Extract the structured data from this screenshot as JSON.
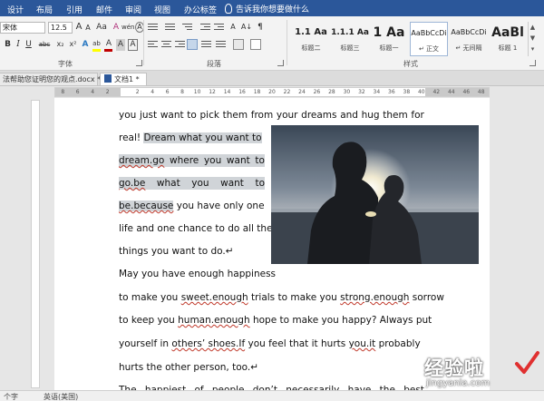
{
  "ribbon_tabs": [
    "设计",
    "布局",
    "引用",
    "邮件",
    "审阅",
    "视图",
    "办公标签"
  ],
  "tell_me": "告诉我你想要做什么",
  "font": {
    "name": "宋体(正文)",
    "name_display": "宋体",
    "size": "12.5"
  },
  "buttons": {
    "grow": "A",
    "shrink": "A",
    "change_case": "Aa",
    "clear_format": "A",
    "phonetic": "wén",
    "enclose": "A",
    "bold": "B",
    "italic": "I",
    "underline": "U",
    "strike": "abc",
    "subscript": "x₂",
    "superscript": "x²",
    "text_effect": "A",
    "highlight": "ab",
    "font_color": "A",
    "char_shading": "A",
    "char_border": "A"
  },
  "paragraph_buttons": {
    "asian_layout": "A",
    "sort": "A↓",
    "show_marks": "¶"
  },
  "colors": {
    "highlight": "#ffff00",
    "font_color": "#c00000",
    "accent": "#2b579a",
    "selection": "#d0d4d8"
  },
  "group_labels": {
    "font": "字体",
    "paragraph": "段落",
    "styles": "样式"
  },
  "styles": [
    {
      "preview": "1.1 Aa",
      "name": "标题二"
    },
    {
      "preview": "1.1.1 Aa",
      "name": "标题三"
    },
    {
      "preview": "1 Aa",
      "name": "标题一"
    },
    {
      "preview": "AaBbCcDi",
      "name": "↵ 正文"
    },
    {
      "preview": "AaBbCcDi",
      "name": "↵ 无间隔"
    },
    {
      "preview": "AaBl",
      "name": "标题 1"
    }
  ],
  "doc_tabs": [
    {
      "label": "法帮助您证明您的观点.docx *"
    },
    {
      "label": "文档1 *"
    }
  ],
  "ruler_ticks": [
    "8",
    "6",
    "4",
    "2",
    "",
    "2",
    "4",
    "6",
    "8",
    "10",
    "12",
    "14",
    "16",
    "18",
    "20",
    "22",
    "24",
    "26",
    "28",
    "30",
    "32",
    "34",
    "36",
    "38",
    "40",
    "42",
    "44",
    "46",
    "48"
  ],
  "document": {
    "lines": [
      {
        "id": "l1",
        "runs": [
          {
            "t": "you just want to pick them from your dreams and hug them for"
          }
        ],
        "justify": true
      },
      {
        "id": "l2",
        "runs": [
          {
            "t": "real! "
          },
          {
            "t": "Dream what you want to",
            "hl": true
          }
        ],
        "justify": false
      },
      {
        "id": "l3",
        "runs": [
          {
            "t": "dream.go",
            "hl": true,
            "sq": true
          },
          {
            "t": "where",
            "hl": true
          },
          {
            "t": "you",
            "hl": true
          },
          {
            "t": "want",
            "hl": true
          },
          {
            "t": "to",
            "hl": true
          }
        ],
        "justify": true,
        "hl_full": true
      },
      {
        "id": "l4",
        "runs": [
          {
            "t": "go.be",
            "hl": true,
            "sq": true
          },
          {
            "t": "what",
            "hl": true
          },
          {
            "t": "you",
            "hl": true
          },
          {
            "t": "want",
            "hl": true
          },
          {
            "t": "to",
            "hl": true
          }
        ],
        "justify": true,
        "hl_full": true
      },
      {
        "id": "l5",
        "runs": [
          {
            "t": "be.because",
            "hl": true,
            "sq": true
          },
          {
            "t": " you have only one"
          }
        ],
        "justify": false
      },
      {
        "id": "l6",
        "runs": [
          {
            "t": "life and one chance to do all the"
          }
        ],
        "justify": false
      },
      {
        "id": "l7",
        "runs": [
          {
            "t": "things you want to do.↵"
          }
        ],
        "justify": false
      },
      {
        "id": "l8",
        "runs": [
          {
            "t": "May you have enough happiness"
          }
        ],
        "justify": false
      },
      {
        "id": "l9",
        "runs": [
          {
            "t": "to make you "
          },
          {
            "t": "sweet.enough",
            "sq": true
          },
          {
            "t": " trials to make you "
          },
          {
            "t": "strong.enough",
            "sq": true
          },
          {
            "t": " sorrow"
          }
        ],
        "justify": false
      },
      {
        "id": "l10",
        "runs": [
          {
            "t": "to keep you "
          },
          {
            "t": "human.enough",
            "sq": true
          },
          {
            "t": " hope to make you happy? Always put"
          }
        ],
        "justify": false
      },
      {
        "id": "l11",
        "runs": [
          {
            "t": "yourself in "
          },
          {
            "t": "others’ shoes.If",
            "sq": true
          },
          {
            "t": " you feel that it hurts "
          },
          {
            "t": "you.it",
            "sq": true
          },
          {
            "t": " probably"
          }
        ],
        "justify": false
      },
      {
        "id": "l12",
        "runs": [
          {
            "t": "hurts the other person, too.↵"
          }
        ],
        "justify": false
      },
      {
        "id": "l13",
        "runs": [
          {
            "t": "The happiest of people don’t necessarily have the best"
          }
        ],
        "justify": true
      }
    ]
  },
  "image": {
    "description": "silhouette of a couple embracing against a sunset over water"
  },
  "status_bar": {
    "chars": "个字",
    "language": "英语(美国)"
  },
  "watermark": {
    "text": "经验啦",
    "url": "jingyanla.com"
  }
}
